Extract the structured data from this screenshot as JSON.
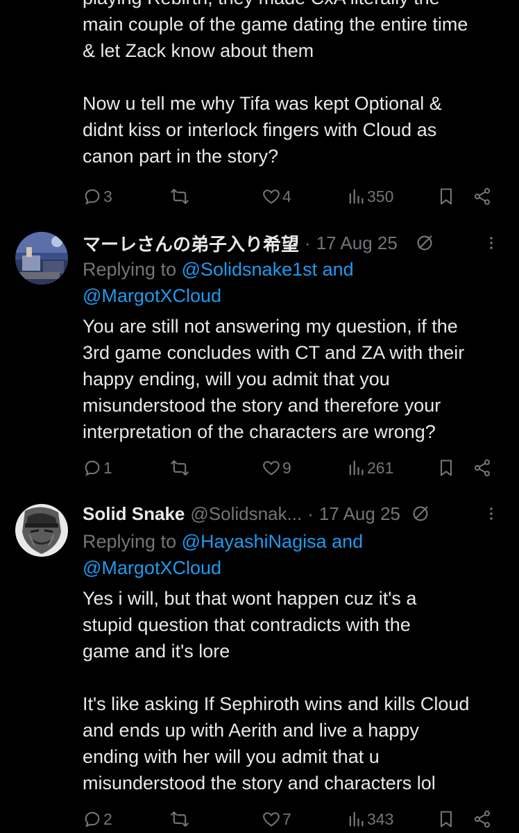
{
  "post1": {
    "text_partial": "playing Rebirth, they made CxA literally the\nmain couple of the game dating the entire time\n& let Zack know about them\n\nNow u tell me why Tifa was kept Optional &\ndidnt kiss or interlock fingers with Cloud as\ncanon part in the story?",
    "replies": "3",
    "reposts": "",
    "likes": "4",
    "views": "350"
  },
  "post2": {
    "name": "マーレさんの弟子入り希望",
    "dot": "·",
    "date": "17 Aug 25",
    "replying_prefix": "Replying to ",
    "mention1": "@Solidsnake1st and",
    "mention2": "@MargotXCloud",
    "text": "You are still not answering my question, if the\n3rd game concludes with CT and ZA with their\nhappy ending, will you admit that you\nmisunderstood the story and therefore your\ninterpretation of the characters are wrong?",
    "replies": "1",
    "likes": "9",
    "views": "261"
  },
  "post3": {
    "name": "Solid Snake",
    "handle": "@Solidsnak...",
    "dot": "·",
    "date": "17 Aug 25",
    "replying_prefix": "Replying to ",
    "mention1": "@HayashiNagisa and",
    "mention2": "@MargotXCloud",
    "text": "Yes i will, but that wont happen cuz it's a\nstupid question that contradicts with the\ngame and it's lore\n\nIt's like asking If Sephiroth wins and kills Cloud\nand ends up with Aerith and live a happy\nending with her will you admit that u\nmisunderstood the story and characters lol",
    "replies": "2",
    "likes": "7",
    "views": "343"
  },
  "icons": {
    "reply": "reply-icon",
    "repost": "repost-icon",
    "like": "heart-icon",
    "views": "views-icon",
    "bookmark": "bookmark-icon",
    "share": "share-icon",
    "grok": "grok-icon",
    "more": "more-icon"
  },
  "colors": {
    "background": "#000000",
    "text": "#e7e9ea",
    "muted": "#71767b",
    "link": "#1d9bf0"
  }
}
